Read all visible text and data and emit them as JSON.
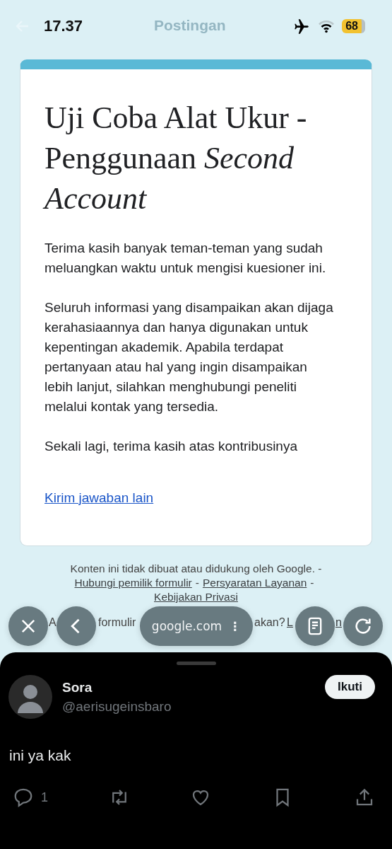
{
  "status_bar": {
    "time": "17.37",
    "battery": "68"
  },
  "header": {
    "title": "Postingan"
  },
  "form": {
    "title": "Uji Coba Alat Ukur - Penggunaan *Second Account*",
    "paragraphs": [
      "Terima kasih banyak teman-teman yang sudah meluangkan waktu untuk mengisi kuesioner ini.",
      "Seluruh informasi yang disampaikan akan dijaga kerahasiaannya dan hanya digunakan untuk kepentingan akademik. Apabila terdapat pertanyaan atau hal yang ingin disampaikan lebih lanjut, silahkan menghubungi peneliti melalui kontak yang tersedia.",
      "Sekali lagi, terima kasih atas kontribusinya"
    ],
    "link": "Kirim jawaban lain"
  },
  "footer": {
    "notice": "Konten ini tidak dibuat atau didukung oleh Google. -",
    "links": [
      "Hubungi pemilik formulir",
      "Persyaratan Layanan",
      "Kebijakan Privasi"
    ],
    "separator": "-",
    "partial_line": [
      {
        "kind": "text",
        "text": "A"
      },
      {
        "kind": "text",
        "text": "formulir"
      },
      {
        "kind": "text",
        "text": "akan?"
      },
      {
        "kind": "link",
        "text": "L"
      },
      {
        "kind": "link",
        "text": "n"
      }
    ]
  },
  "browser_bar": {
    "url": "google.com",
    "more": "⋮"
  },
  "post": {
    "name": "Sora",
    "handle": "@aerisugeinsbaro",
    "follow": "Ikuti",
    "text": "ini ya kak",
    "replies": "1"
  }
}
